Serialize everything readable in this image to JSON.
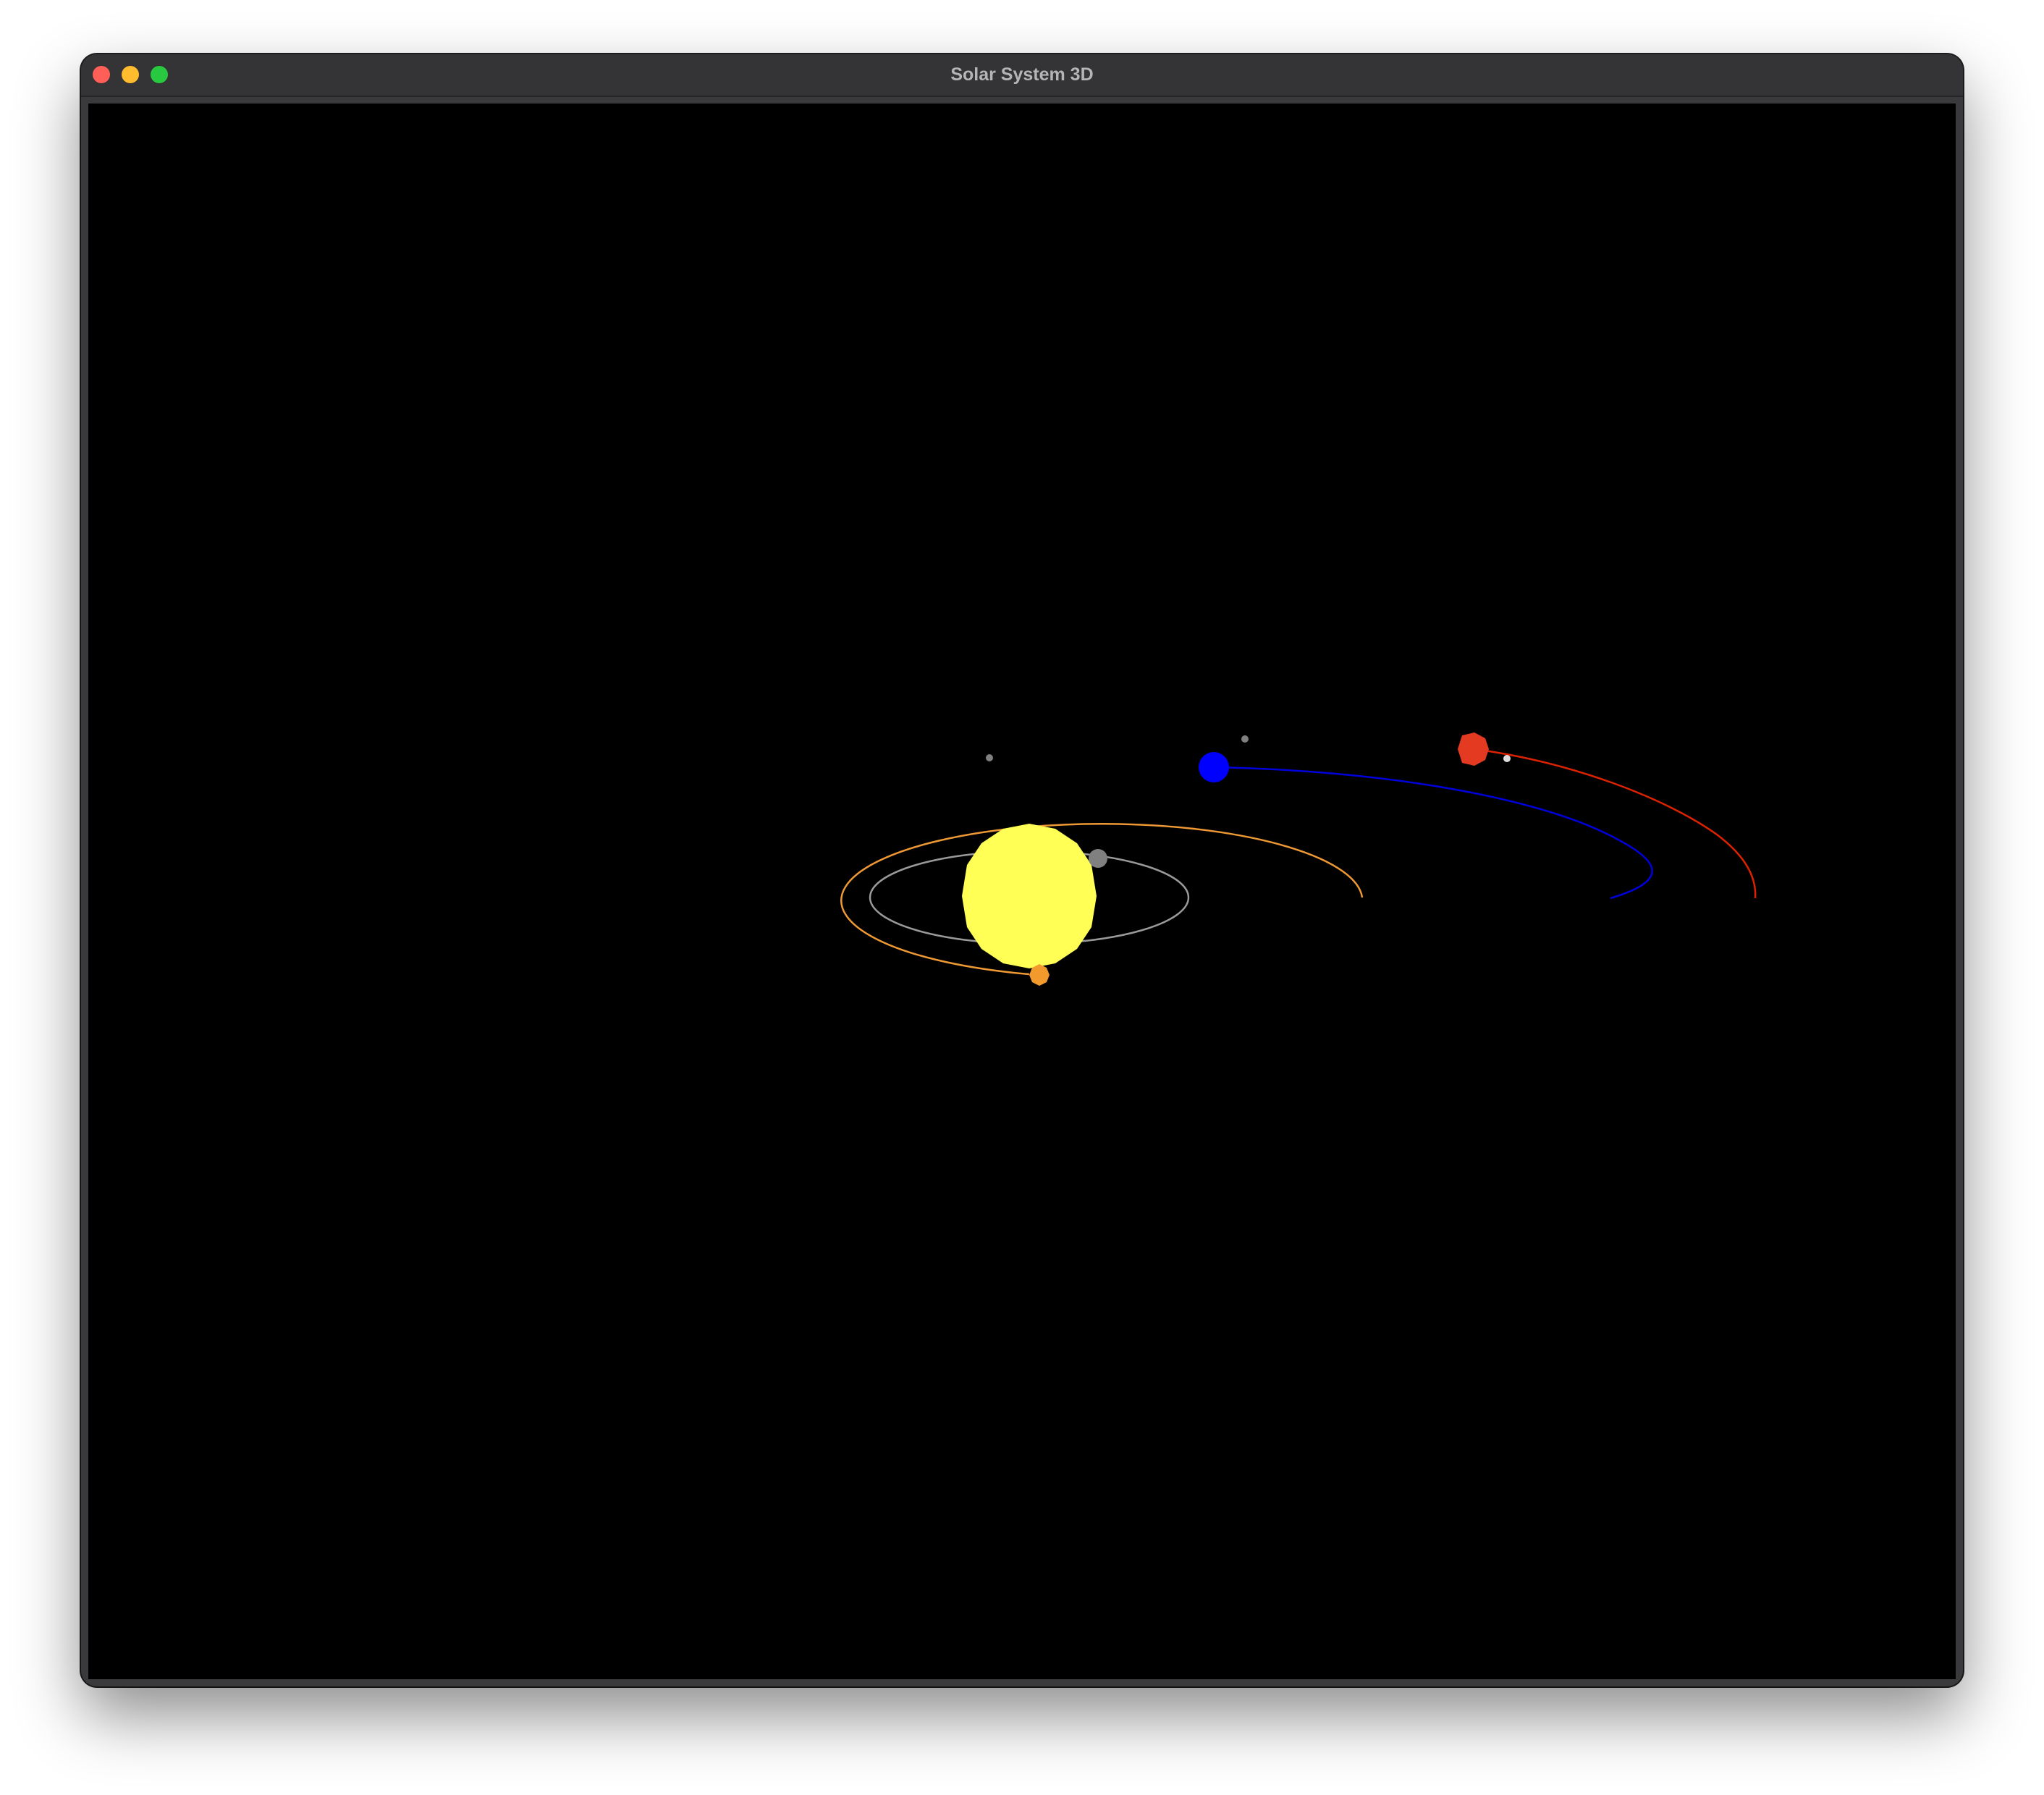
{
  "window": {
    "title": "Solar System 3D"
  },
  "scene": {
    "background": "#000000",
    "sun_color": "#ffff55",
    "orbits": [
      {
        "name": "mercury-orbit",
        "color": "#9a9a9a"
      },
      {
        "name": "venus-orbit",
        "color": "#ee9933"
      },
      {
        "name": "earth-orbit",
        "color": "#0000dd"
      },
      {
        "name": "mars-orbit",
        "color": "#dd2200"
      }
    ],
    "bodies": [
      {
        "name": "mercury",
        "color": "#808080"
      },
      {
        "name": "venus",
        "color": "#f39a2c"
      },
      {
        "name": "earth",
        "color": "#0000ff"
      },
      {
        "name": "mars",
        "color": "#e53a22"
      },
      {
        "name": "moon",
        "color": "#dddddd"
      }
    ]
  }
}
